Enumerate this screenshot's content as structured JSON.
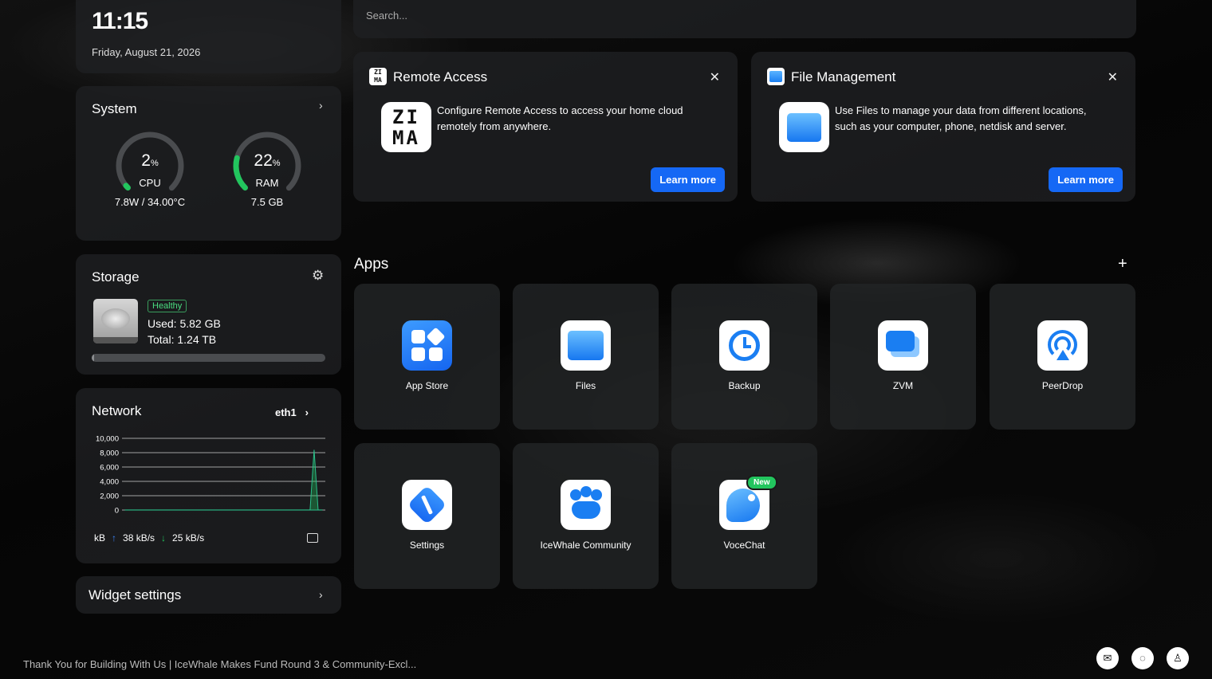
{
  "clock": {
    "time": "11:15",
    "date": "Friday, August 21, 2026"
  },
  "system": {
    "title": "System",
    "cpu": {
      "value": "2",
      "unit": "%",
      "percent": 2,
      "label": "CPU",
      "detail": "7.8W / 34.00°C"
    },
    "ram": {
      "value": "22",
      "unit": "%",
      "percent": 22,
      "label": "RAM",
      "detail": "7.5 GB"
    }
  },
  "storage": {
    "title": "Storage",
    "status": "Healthy",
    "used": "Used: 5.82 GB",
    "total": "Total: 1.24 TB",
    "usage_fraction": 0.005
  },
  "network": {
    "title": "Network",
    "interface": "eth1",
    "unit": "kB",
    "upload": "38 kB/s",
    "download": "25 kB/s"
  },
  "chart_data": {
    "type": "area",
    "title": "",
    "xlabel": "",
    "ylabel": "",
    "ylim": [
      0,
      10000
    ],
    "yticks": [
      "10,000",
      "8,000",
      "6,000",
      "4,000",
      "2,000",
      "0"
    ],
    "grid": true,
    "series": [
      {
        "values": [
          20,
          20,
          20,
          20,
          20,
          20,
          20,
          20,
          20,
          20,
          20,
          20,
          20,
          20,
          20,
          20,
          20,
          20,
          20,
          20,
          20,
          20,
          20,
          20,
          20,
          20,
          20,
          20,
          20,
          20,
          20,
          20,
          20,
          20,
          20,
          20,
          20,
          20,
          20,
          20,
          20,
          20,
          20,
          20,
          20,
          20,
          20,
          8400,
          20,
          20
        ]
      }
    ]
  },
  "widget_settings": {
    "label": "Widget settings"
  },
  "search": {
    "placeholder": "Search..."
  },
  "cards": [
    {
      "title": "Remote Access",
      "logo_text": "ZI MA",
      "description": "Configure Remote Access to access your home cloud remotely from anywhere.",
      "button": "Learn more",
      "icon": "zima-logo-icon"
    },
    {
      "title": "File Management",
      "description": "Use Files to manage your data from different locations, such as your computer, phone, netdisk and server.",
      "button": "Learn more",
      "icon": "folder-icon"
    }
  ],
  "apps": {
    "title": "Apps",
    "items": [
      {
        "name": "App Store",
        "icon": "app-store-icon"
      },
      {
        "name": "Files",
        "icon": "files-icon"
      },
      {
        "name": "Backup",
        "icon": "backup-icon"
      },
      {
        "name": "ZVM",
        "icon": "zvm-icon"
      },
      {
        "name": "PeerDrop",
        "icon": "peerdrop-icon"
      },
      {
        "name": "Settings",
        "icon": "settings-icon"
      },
      {
        "name": "IceWhale Community",
        "icon": "community-icon"
      },
      {
        "name": "VoceChat",
        "icon": "vocechat-icon",
        "badge": "New"
      }
    ]
  },
  "footer": {
    "news": "Thank You for Building With Us | IceWhale Makes Fund Round 3 & Community-Excl..."
  },
  "colors": {
    "accent": "#1568f5",
    "gauge": "#22c55e",
    "healthy": "#4ade80",
    "upload": "#3b82f6",
    "download": "#22c55e"
  }
}
